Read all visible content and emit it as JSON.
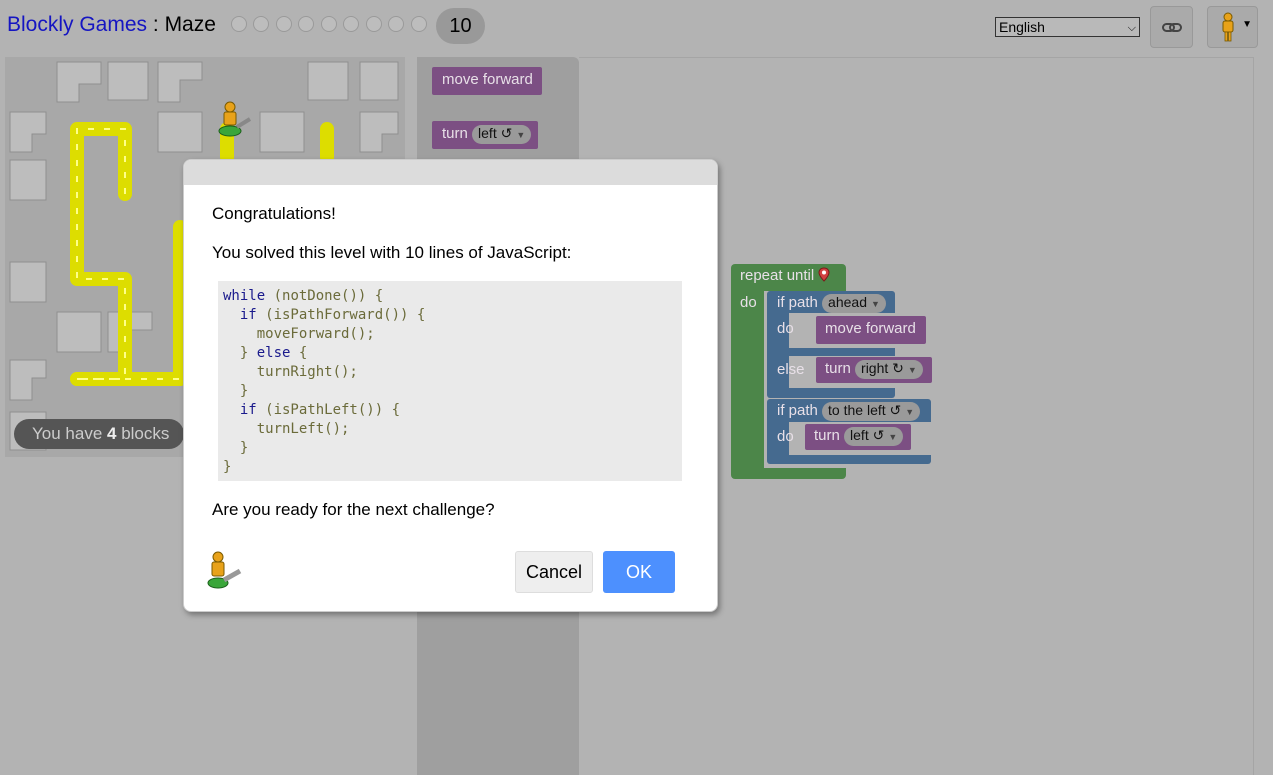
{
  "header": {
    "app_link": "Blockly Games",
    "separator": " : ",
    "game_title": "Maze",
    "current_level": "10",
    "language": "English"
  },
  "maze": {
    "blocks_prefix": "You have ",
    "blocks_count": "4",
    "blocks_suffix": " blocks"
  },
  "toolbox": {
    "move_forward": "move forward",
    "turn_label": "turn",
    "turn_dir": "left ↺"
  },
  "workspace": {
    "repeat_until": "repeat until",
    "do1": "do",
    "if_path1": "if path",
    "ahead": "ahead",
    "do2": "do",
    "move_forward": "move forward",
    "else": "else",
    "turn1": "turn",
    "right": "right ↻",
    "if_path2": "if path",
    "to_the_left": "to the left ↺",
    "do3": "do",
    "turn2": "turn",
    "left": "left ↺"
  },
  "dialog": {
    "congrats": "Congratulations!",
    "solved": "You solved this level with 10 lines of JavaScript:",
    "ready": "Are you ready for the next challenge?",
    "cancel": "Cancel",
    "ok": "OK",
    "code": {
      "l1a": "while",
      "l1b": " (notDone()) {",
      "l2a": "  if",
      "l2b": " (isPathForward()) {",
      "l3": "    moveForward();",
      "l4a": "  } ",
      "l4b": "else",
      "l4c": " {",
      "l5": "    turnRight();",
      "l6": "  }",
      "l7a": "  if",
      "l7b": " (isPathLeft()) {",
      "l8": "    turnLeft();",
      "l9": "  }",
      "l10": "}"
    }
  }
}
